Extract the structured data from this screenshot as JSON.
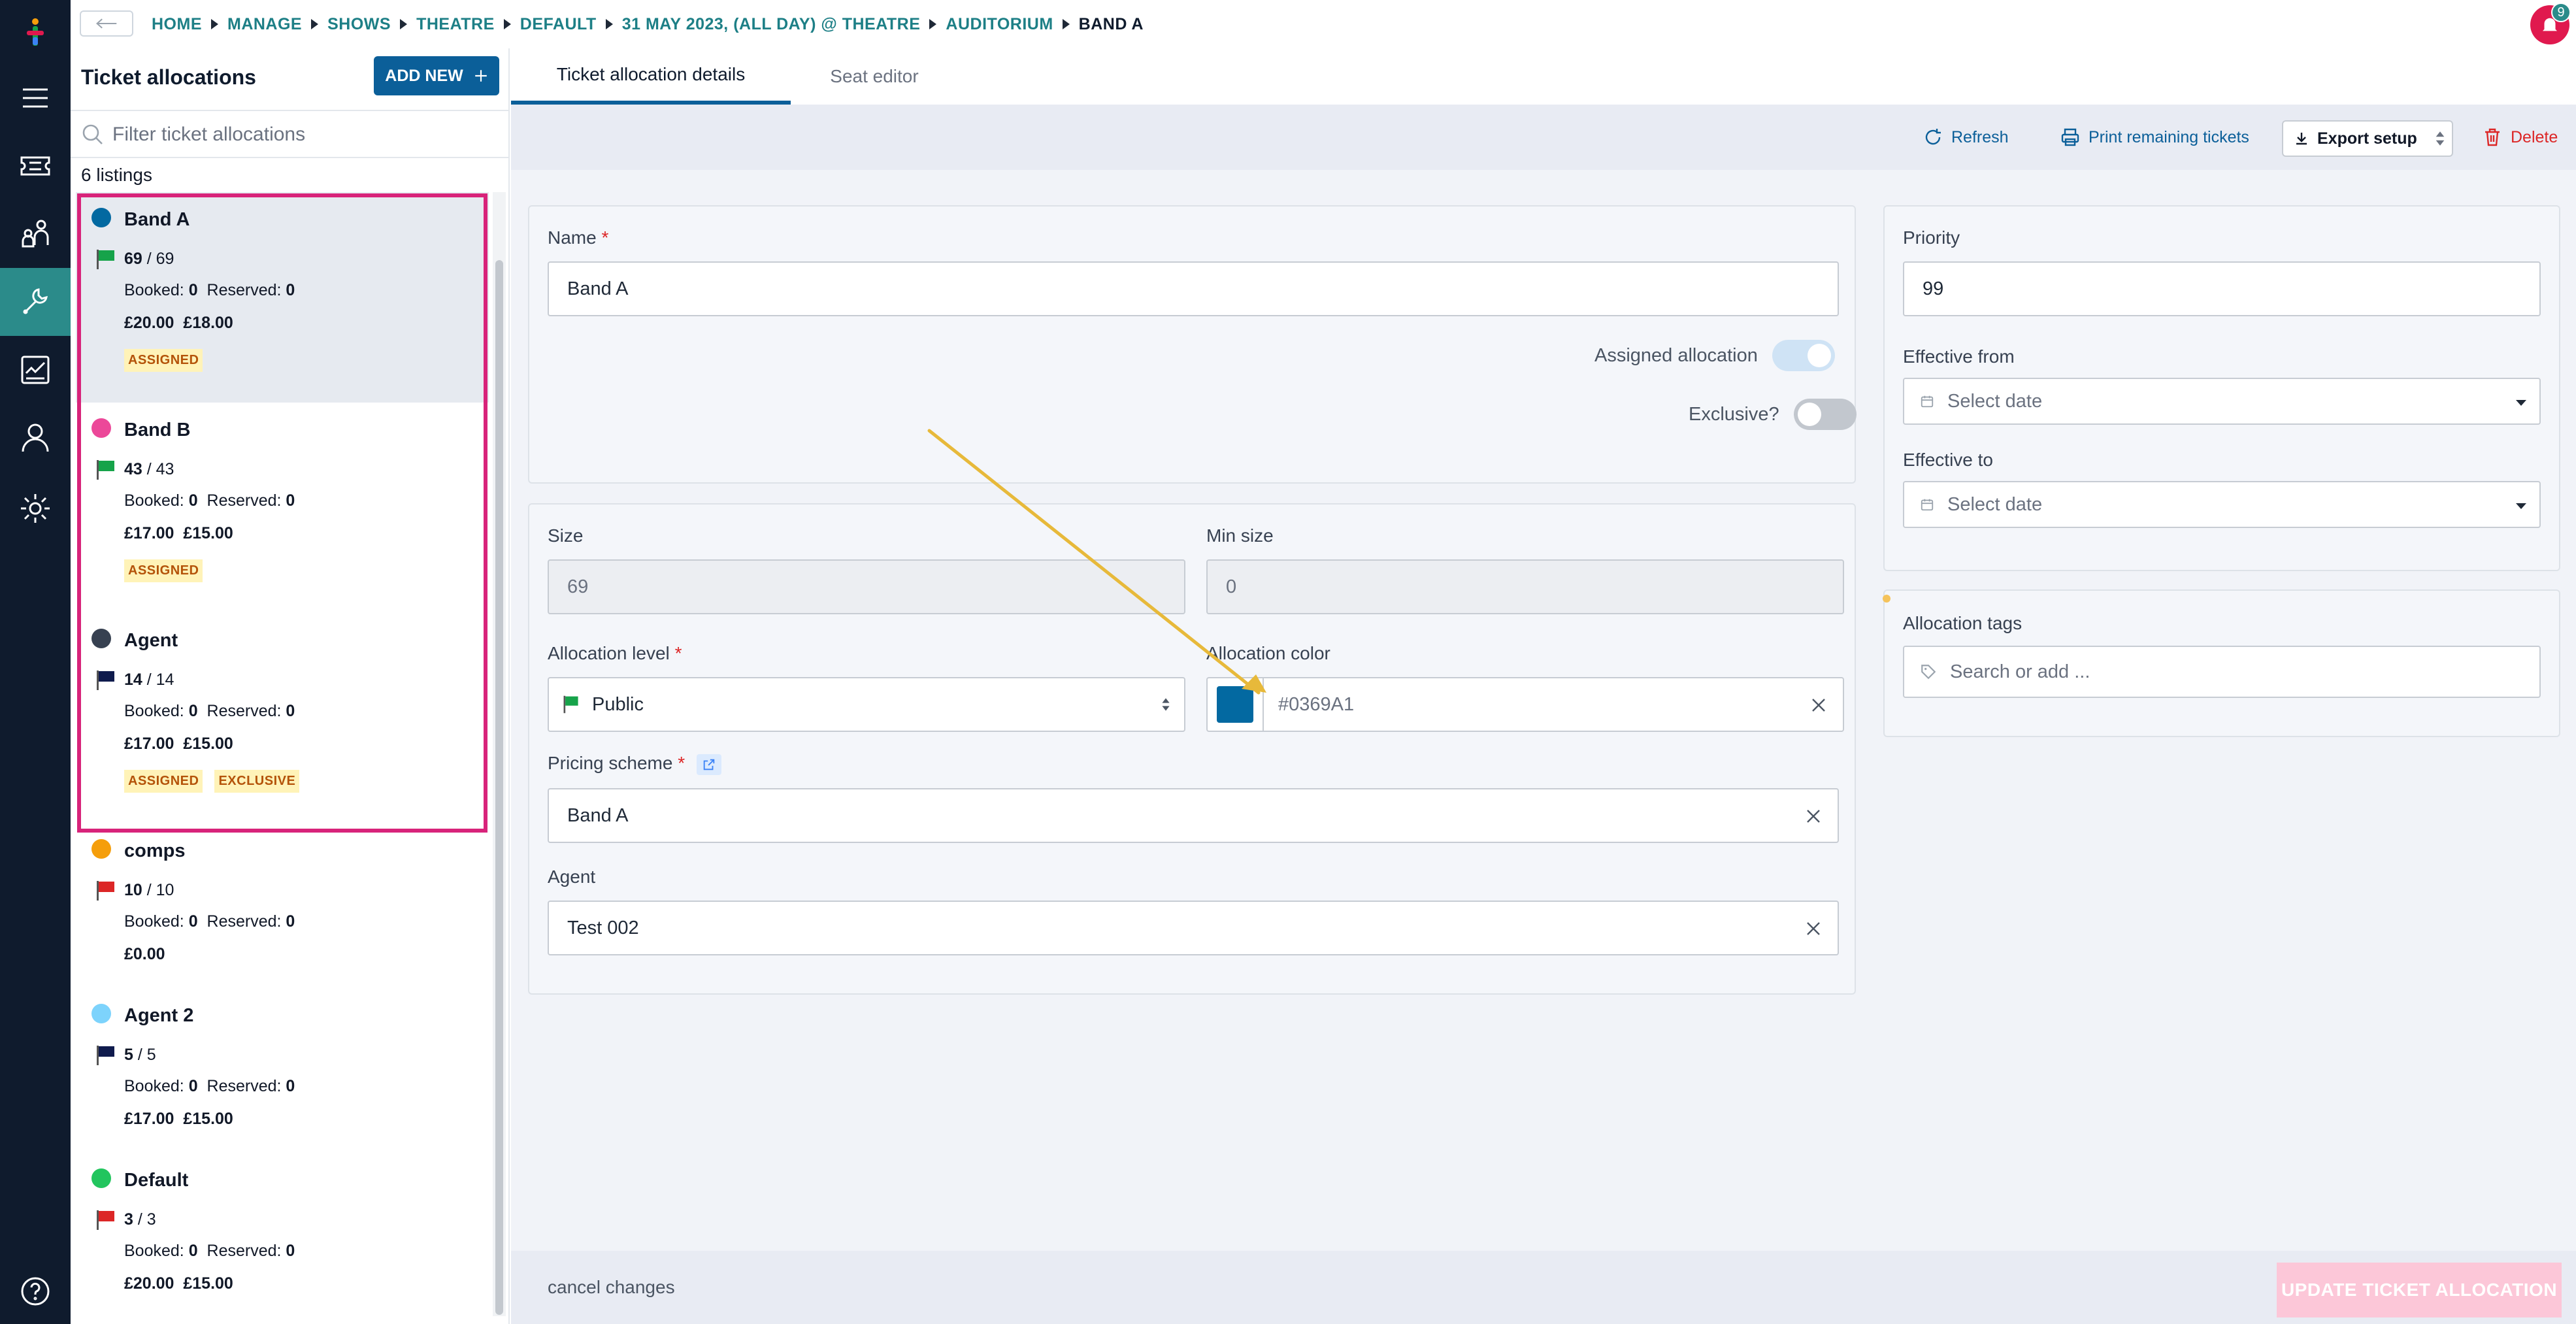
{
  "breadcrumb": [
    "HOME",
    "MANAGE",
    "SHOWS",
    "THEATRE",
    "DEFAULT",
    "31 MAY 2023, (ALL DAY) @ THEATRE",
    "AUDITORIUM",
    "BAND A"
  ],
  "notifications": {
    "count": "9"
  },
  "list": {
    "title": "Ticket allocations",
    "add_new_label": "ADD NEW",
    "filter_placeholder": "Filter ticket allocations",
    "listing_count": "6 listings",
    "booked_label": "Booked:",
    "reserved_label": "Reserved:",
    "items": [
      {
        "name": "Band A",
        "color": "#0369A1",
        "flag": "#16a34a",
        "available": "69",
        "total": "69",
        "booked": "0",
        "reserved": "0",
        "prices": "£20.00  £18.00",
        "tags": [
          "ASSIGNED"
        ],
        "selected": true
      },
      {
        "name": "Band B",
        "color": "#ec4899",
        "flag": "#16a34a",
        "available": "43",
        "total": "43",
        "booked": "0",
        "reserved": "0",
        "prices": "£17.00  £15.00",
        "tags": [
          "ASSIGNED"
        ]
      },
      {
        "name": "Agent",
        "color": "#374151",
        "flag": "#0f1b4d",
        "available": "14",
        "total": "14",
        "booked": "0",
        "reserved": "0",
        "prices": "£17.00  £15.00",
        "tags": [
          "ASSIGNED",
          "EXCLUSIVE"
        ]
      },
      {
        "name": "comps",
        "color": "#f59e0b",
        "flag": "#dc2626",
        "available": "10",
        "total": "10",
        "booked": "0",
        "reserved": "0",
        "prices": "£0.00",
        "tags": []
      },
      {
        "name": "Agent 2",
        "color": "#7dd3fc",
        "flag": "#0f1b4d",
        "available": "5",
        "total": "5",
        "booked": "0",
        "reserved": "0",
        "prices": "£17.00  £15.00",
        "tags": []
      },
      {
        "name": "Default",
        "color": "#22c55e",
        "flag": "#dc2626",
        "available": "3",
        "total": "3",
        "booked": "0",
        "reserved": "0",
        "prices": "£20.00  £15.00",
        "tags": []
      }
    ]
  },
  "tabs": {
    "details": "Ticket allocation details",
    "seat_editor": "Seat editor"
  },
  "toolbar": {
    "refresh": "Refresh",
    "print": "Print remaining tickets",
    "export": "Export setup",
    "delete": "Delete"
  },
  "form": {
    "name_label": "Name",
    "name_value": "Band A",
    "assigned_label": "Assigned allocation",
    "exclusive_label": "Exclusive?",
    "size_label": "Size",
    "size_value": "69",
    "min_size_label": "Min size",
    "min_size_value": "0",
    "level_label": "Allocation level",
    "level_value": "Public",
    "color_label": "Allocation color",
    "color_value": "#0369A1",
    "pricing_label": "Pricing scheme",
    "pricing_value": "Band A",
    "agent_label": "Agent",
    "agent_value": "Test 002",
    "priority_label": "Priority",
    "priority_value": "99",
    "effective_from_label": "Effective from",
    "effective_to_label": "Effective to",
    "date_placeholder": "Select date",
    "tags_label": "Allocation tags",
    "tags_placeholder": "Search or add ..."
  },
  "footer": {
    "cancel": "cancel changes",
    "update": "UPDATE TICKET ALLOCATION"
  },
  "colors": {
    "accent": "#0b5f99",
    "teal": "#1d7f86",
    "highlight": "#d8237a",
    "delete": "#dc2626"
  }
}
